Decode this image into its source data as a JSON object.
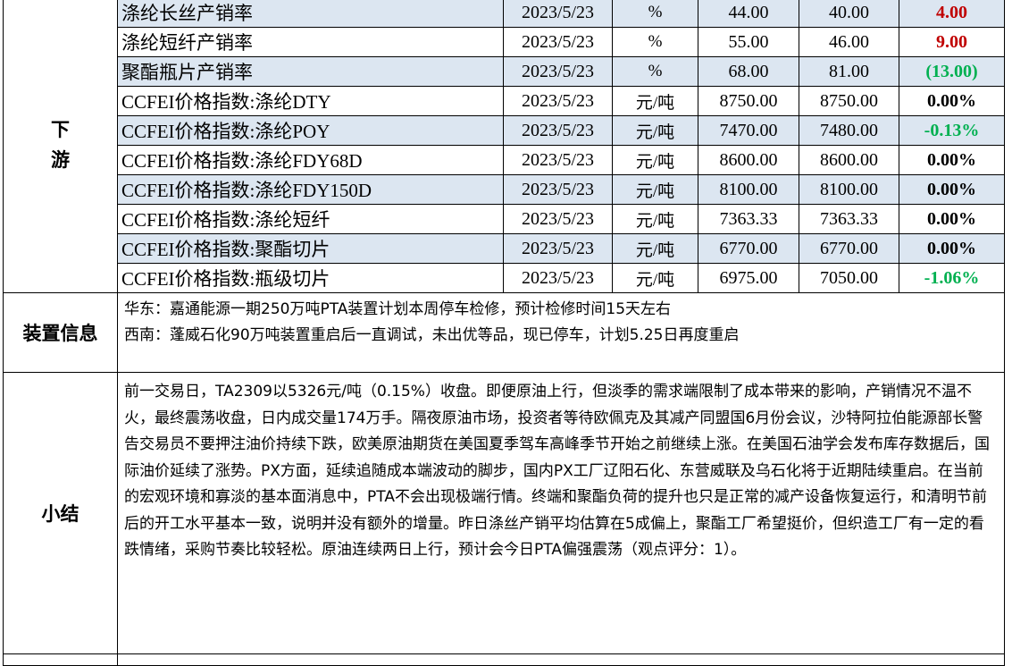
{
  "downstream": {
    "category_label": "下游",
    "rows": [
      {
        "name": "涤纶长丝产销率",
        "date": "2023/5/23",
        "unit": "%",
        "current": "44.00",
        "previous": "40.00",
        "change": "4.00",
        "direction": "up"
      },
      {
        "name": "涤纶短纤产销率",
        "date": "2023/5/23",
        "unit": "%",
        "current": "55.00",
        "previous": "46.00",
        "change": "9.00",
        "direction": "up"
      },
      {
        "name": "聚酯瓶片产销率",
        "date": "2023/5/23",
        "unit": "%",
        "current": "68.00",
        "previous": "81.00",
        "change": "(13.00)",
        "direction": "down"
      },
      {
        "name": "CCFEI价格指数:涤纶DTY",
        "date": "2023/5/23",
        "unit": "元/吨",
        "current": "8750.00",
        "previous": "8750.00",
        "change": "0.00%",
        "direction": "flat"
      },
      {
        "name": "CCFEI价格指数:涤纶POY",
        "date": "2023/5/23",
        "unit": "元/吨",
        "current": "7470.00",
        "previous": "7480.00",
        "change": "-0.13%",
        "direction": "down"
      },
      {
        "name": "CCFEI价格指数:涤纶FDY68D",
        "date": "2023/5/23",
        "unit": "元/吨",
        "current": "8600.00",
        "previous": "8600.00",
        "change": "0.00%",
        "direction": "flat"
      },
      {
        "name": "CCFEI价格指数:涤纶FDY150D",
        "date": "2023/5/23",
        "unit": "元/吨",
        "current": "8100.00",
        "previous": "8100.00",
        "change": "0.00%",
        "direction": "flat"
      },
      {
        "name": "CCFEI价格指数:涤纶短纤",
        "date": "2023/5/23",
        "unit": "元/吨",
        "current": "7363.33",
        "previous": "7363.33",
        "change": "0.00%",
        "direction": "flat"
      },
      {
        "name": "CCFEI价格指数:聚酯切片",
        "date": "2023/5/23",
        "unit": "元/吨",
        "current": "6770.00",
        "previous": "6770.00",
        "change": "0.00%",
        "direction": "flat"
      },
      {
        "name": "CCFEI价格指数:瓶级切片",
        "date": "2023/5/23",
        "unit": "元/吨",
        "current": "6975.00",
        "previous": "7050.00",
        "change": "-1.06%",
        "direction": "down"
      }
    ]
  },
  "device_info": {
    "label": "装置信息",
    "lines": [
      "华东：嘉通能源一期250万吨PTA装置计划本周停车检修，预计检修时间15天左右",
      "西南：蓬威石化90万吨装置重启后一直调试，未出优等品，现已停车，计划5.25日再度重启"
    ]
  },
  "summary": {
    "label": "小结",
    "text": "前一交易日，TA2309以5326元/吨（0.15%）收盘。即便原油上行，但淡季的需求端限制了成本带来的影响，产销情况不温不火，最终震荡收盘，日内成交量174万手。隔夜原油市场，投资者等待欧佩克及其减产同盟国6月份会议，沙特阿拉伯能源部长警告交易员不要押注油价持续下跌，欧美原油期货在美国夏季驾车高峰季节开始之前继续上涨。在美国石油学会发布库存数据后，国际油价延续了涨势。PX方面，延续追随成本端波动的脚步，国内PX工厂辽阳石化、东营威联及乌石化将于近期陆续重启。在当前的宏观环境和寡淡的基本面消息中，PTA不会出现极端行情。终端和聚酯负荷的提升也只是正常的减产设备恢复运行，和清明节前后的开工水平基本一致，说明并没有额外的增量。昨日涤丝产销平均估算在5成偏上，聚酯工厂希望挺价，但织造工厂有一定的看跌情绪，采购节奏比较轻松。原油连续两日上行，预计会今日PTA偏强震荡（观点评分：1）。"
  },
  "colors": {
    "row_shade": "#dce6f1",
    "up": "#c00000",
    "down": "#00b050",
    "border": "#000000"
  }
}
